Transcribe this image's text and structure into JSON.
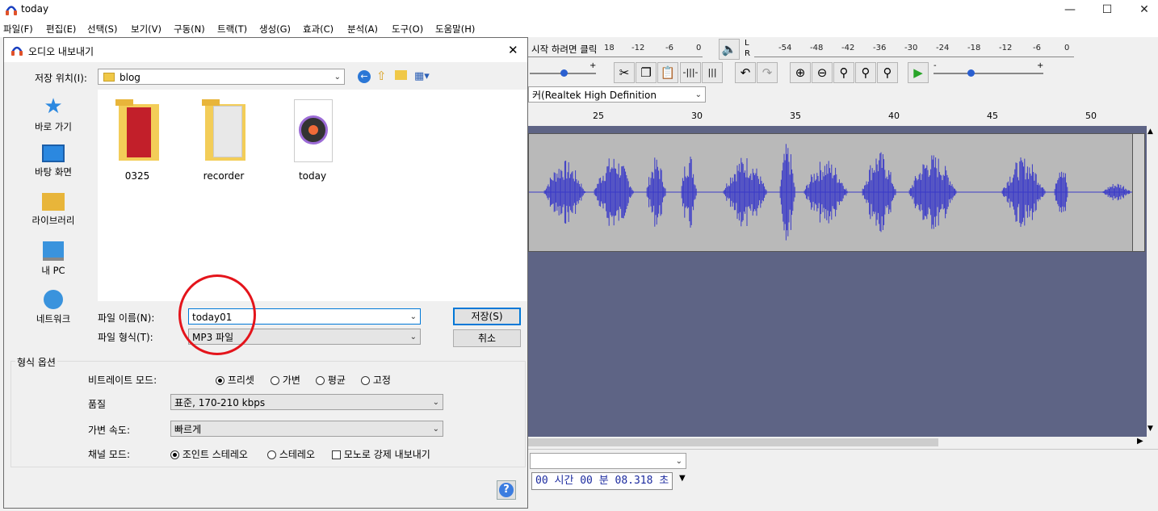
{
  "app": {
    "title": "today"
  },
  "menu": [
    "파일(F)",
    "편집(E)",
    "선택(S)",
    "보기(V)",
    "구동(N)",
    "트랙(T)",
    "생성(G)",
    "효과(C)",
    "분석(A)",
    "도구(O)",
    "도움말(H)"
  ],
  "toolbar": {
    "record_meter_hint": "시작 하려면 클릭",
    "record_meter_ticks": [
      "18",
      "-12",
      "-6",
      "0"
    ],
    "playback_meter_lr": [
      "L",
      "R"
    ],
    "playback_meter_ticks": [
      "-54",
      "-48",
      "-42",
      "-36",
      "-30",
      "-24",
      "-18",
      "-12",
      "-6",
      "0"
    ],
    "device_combo": "커(Realtek High Definition",
    "slider_plus": "+",
    "slider_minus": "-"
  },
  "ruler": {
    "ticks": [
      "25",
      "30",
      "35",
      "40",
      "45",
      "50"
    ]
  },
  "bottom": {
    "time_display": "00 시간 00 분 08.318 초"
  },
  "dialog": {
    "title": "오디오 내보내기",
    "save_location_label": "저장 위치(I):",
    "save_location_value": "blog",
    "places": [
      "바로 가기",
      "바탕 화면",
      "라이브러리",
      "내 PC",
      "네트워크"
    ],
    "files": [
      "0325",
      "recorder",
      "today"
    ],
    "filename_label": "파일 이름(N):",
    "filename_value": "today01",
    "filetype_label": "파일 형식(T):",
    "filetype_value": "MP3 파일",
    "save_button": "저장(S)",
    "cancel_button": "취소",
    "options_title": "형식 옵션",
    "bitrate_mode_label": "비트레이트 모드:",
    "bitrate_modes": [
      "프리셋",
      "가변",
      "평균",
      "고정"
    ],
    "quality_label": "품질",
    "quality_value": "표준, 170-210 kbps",
    "variable_speed_label": "가변 속도:",
    "variable_speed_value": "빠르게",
    "channel_mode_label": "채널 모드:",
    "channel_modes": [
      "조인트 스테레오",
      "스테레오"
    ],
    "force_mono_label": "모노로 강제 내보내기",
    "help_icon": "?"
  }
}
